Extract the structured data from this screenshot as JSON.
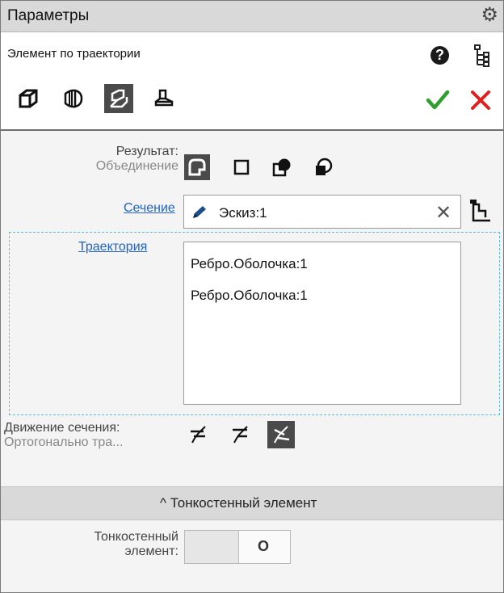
{
  "titlebar": {
    "title": "Параметры"
  },
  "header": {
    "subtitle": "Элемент по траектории",
    "operation_buttons": [
      "extrusion-op",
      "rotation-op",
      "sweep-op",
      "loft-op"
    ],
    "selected_operation": "sweep-op"
  },
  "result": {
    "label_line1": "Результат:",
    "label_line2": "Объединение",
    "options": [
      "union",
      "subtract",
      "intersect",
      "cut-intersect"
    ],
    "selected": "union"
  },
  "section": {
    "link": "Сечение",
    "value": "Эскиз:1"
  },
  "trajectory": {
    "link": "Траектория",
    "items": [
      "Ребро.Оболочка:1",
      "Ребро.Оболочка:1"
    ]
  },
  "motion": {
    "label_line1": "Движение сечения:",
    "label_line2": "Ортогонально тра...",
    "selected": "orthogonal"
  },
  "thin_wall": {
    "header": "Тонкостенный элемент",
    "label_line1": "Тонкостенный",
    "label_line2": "элемент:",
    "toggle_state_symbol": "O"
  },
  "colors": {
    "accept": "#2e9e2e",
    "cancel": "#e02020",
    "link": "#1f63c6",
    "selected_button": "#4a4a4a",
    "focus_border": "#5bc0de"
  }
}
